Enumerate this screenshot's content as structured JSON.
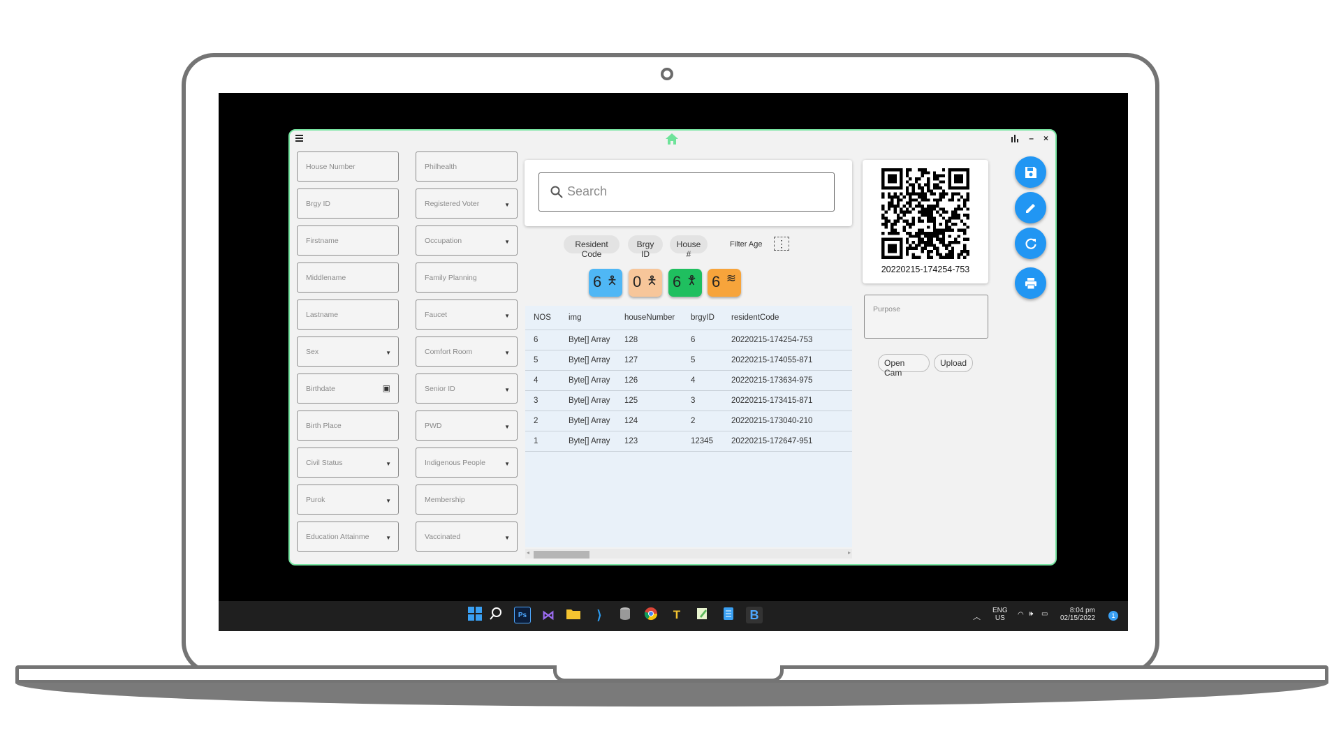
{
  "colors": {
    "accent": "#2196f3",
    "window_border": "#79e6a3",
    "home_icon": "#6fe39a"
  },
  "titlebar": {
    "menu_icon": "hamburger-menu-icon",
    "home_icon": "home-icon",
    "controls": [
      "bar-chart-icon",
      "minimize-icon",
      "close-icon"
    ],
    "minimize": "–",
    "close": "×"
  },
  "left_fields": [
    {
      "label": "House Number"
    },
    {
      "label": "Brgy ID"
    },
    {
      "label": "Firstname"
    },
    {
      "label": "Middlename"
    },
    {
      "label": "Lastname"
    },
    {
      "label": "Sex",
      "dropdown": true
    },
    {
      "label": "Birthdate",
      "date": true
    },
    {
      "label": "Birth Place"
    },
    {
      "label": "Civil Status",
      "dropdown": true
    },
    {
      "label": "Purok",
      "dropdown": true
    },
    {
      "label": "Education Attainme",
      "dropdown": true
    }
  ],
  "right_fields": [
    {
      "label": "Philhealth"
    },
    {
      "label": "Registered Voter",
      "dropdown": true
    },
    {
      "label": "Occupation",
      "dropdown": true
    },
    {
      "label": "Family Planning"
    },
    {
      "label": "Faucet",
      "dropdown": true
    },
    {
      "label": "Comfort Room",
      "dropdown": true
    },
    {
      "label": "Senior ID",
      "dropdown": true
    },
    {
      "label": "PWD",
      "dropdown": true
    },
    {
      "label": "Indigenous People",
      "dropdown": true
    },
    {
      "label": "Membership"
    },
    {
      "label": "Vaccinated",
      "dropdown": true
    }
  ],
  "search": {
    "placeholder": "Search"
  },
  "filter_chips": [
    "Resident Code",
    "Brgy ID",
    "House #"
  ],
  "filter_age_label": "Filter Age",
  "stats": [
    {
      "value": "6",
      "color": "#4fb7f5",
      "icon": "male-icon"
    },
    {
      "value": "0",
      "color": "#f7c69a",
      "icon": "female-icon"
    },
    {
      "value": "6",
      "color": "#1fbf5f",
      "icon": "senior-icon"
    },
    {
      "value": "6",
      "color": "#f7a43b",
      "icon": "coins-icon"
    }
  ],
  "table": {
    "columns": [
      "NOS",
      "img",
      "houseNumber",
      "brgyID",
      "residentCode"
    ],
    "rows": [
      [
        "6",
        "Byte[] Array",
        "128",
        "6",
        "20220215-174254-753"
      ],
      [
        "5",
        "Byte[] Array",
        "127",
        "5",
        "20220215-174055-871"
      ],
      [
        "4",
        "Byte[] Array",
        "126",
        "4",
        "20220215-173634-975"
      ],
      [
        "3",
        "Byte[] Array",
        "125",
        "3",
        "20220215-173415-871"
      ],
      [
        "2",
        "Byte[] Array",
        "124",
        "2",
        "20220215-173040-210"
      ],
      [
        "1",
        "Byte[] Array",
        "123",
        "12345",
        "20220215-172647-951"
      ]
    ]
  },
  "qr": {
    "code": "20220215-174254-753"
  },
  "purpose": {
    "placeholder": "Purpose"
  },
  "buttons": {
    "open_cam": "Open Cam",
    "upload": "Upload"
  },
  "fabs": [
    "save-icon",
    "edit-icon",
    "refresh-icon",
    "print-icon"
  ],
  "taskbar": {
    "apps": [
      "windows-start-icon",
      "search-icon",
      "photoshop-icon",
      "visual-studio-icon",
      "file-explorer-icon",
      "vscode-icon",
      "database-icon",
      "chrome-icon",
      "typora-icon",
      "notepad-plus-icon",
      "notepad-icon",
      "app-b-icon"
    ],
    "lang_top": "ENG",
    "lang_bottom": "US",
    "time": "8:04 pm",
    "date": "02/15/2022",
    "notification_count": "1"
  }
}
